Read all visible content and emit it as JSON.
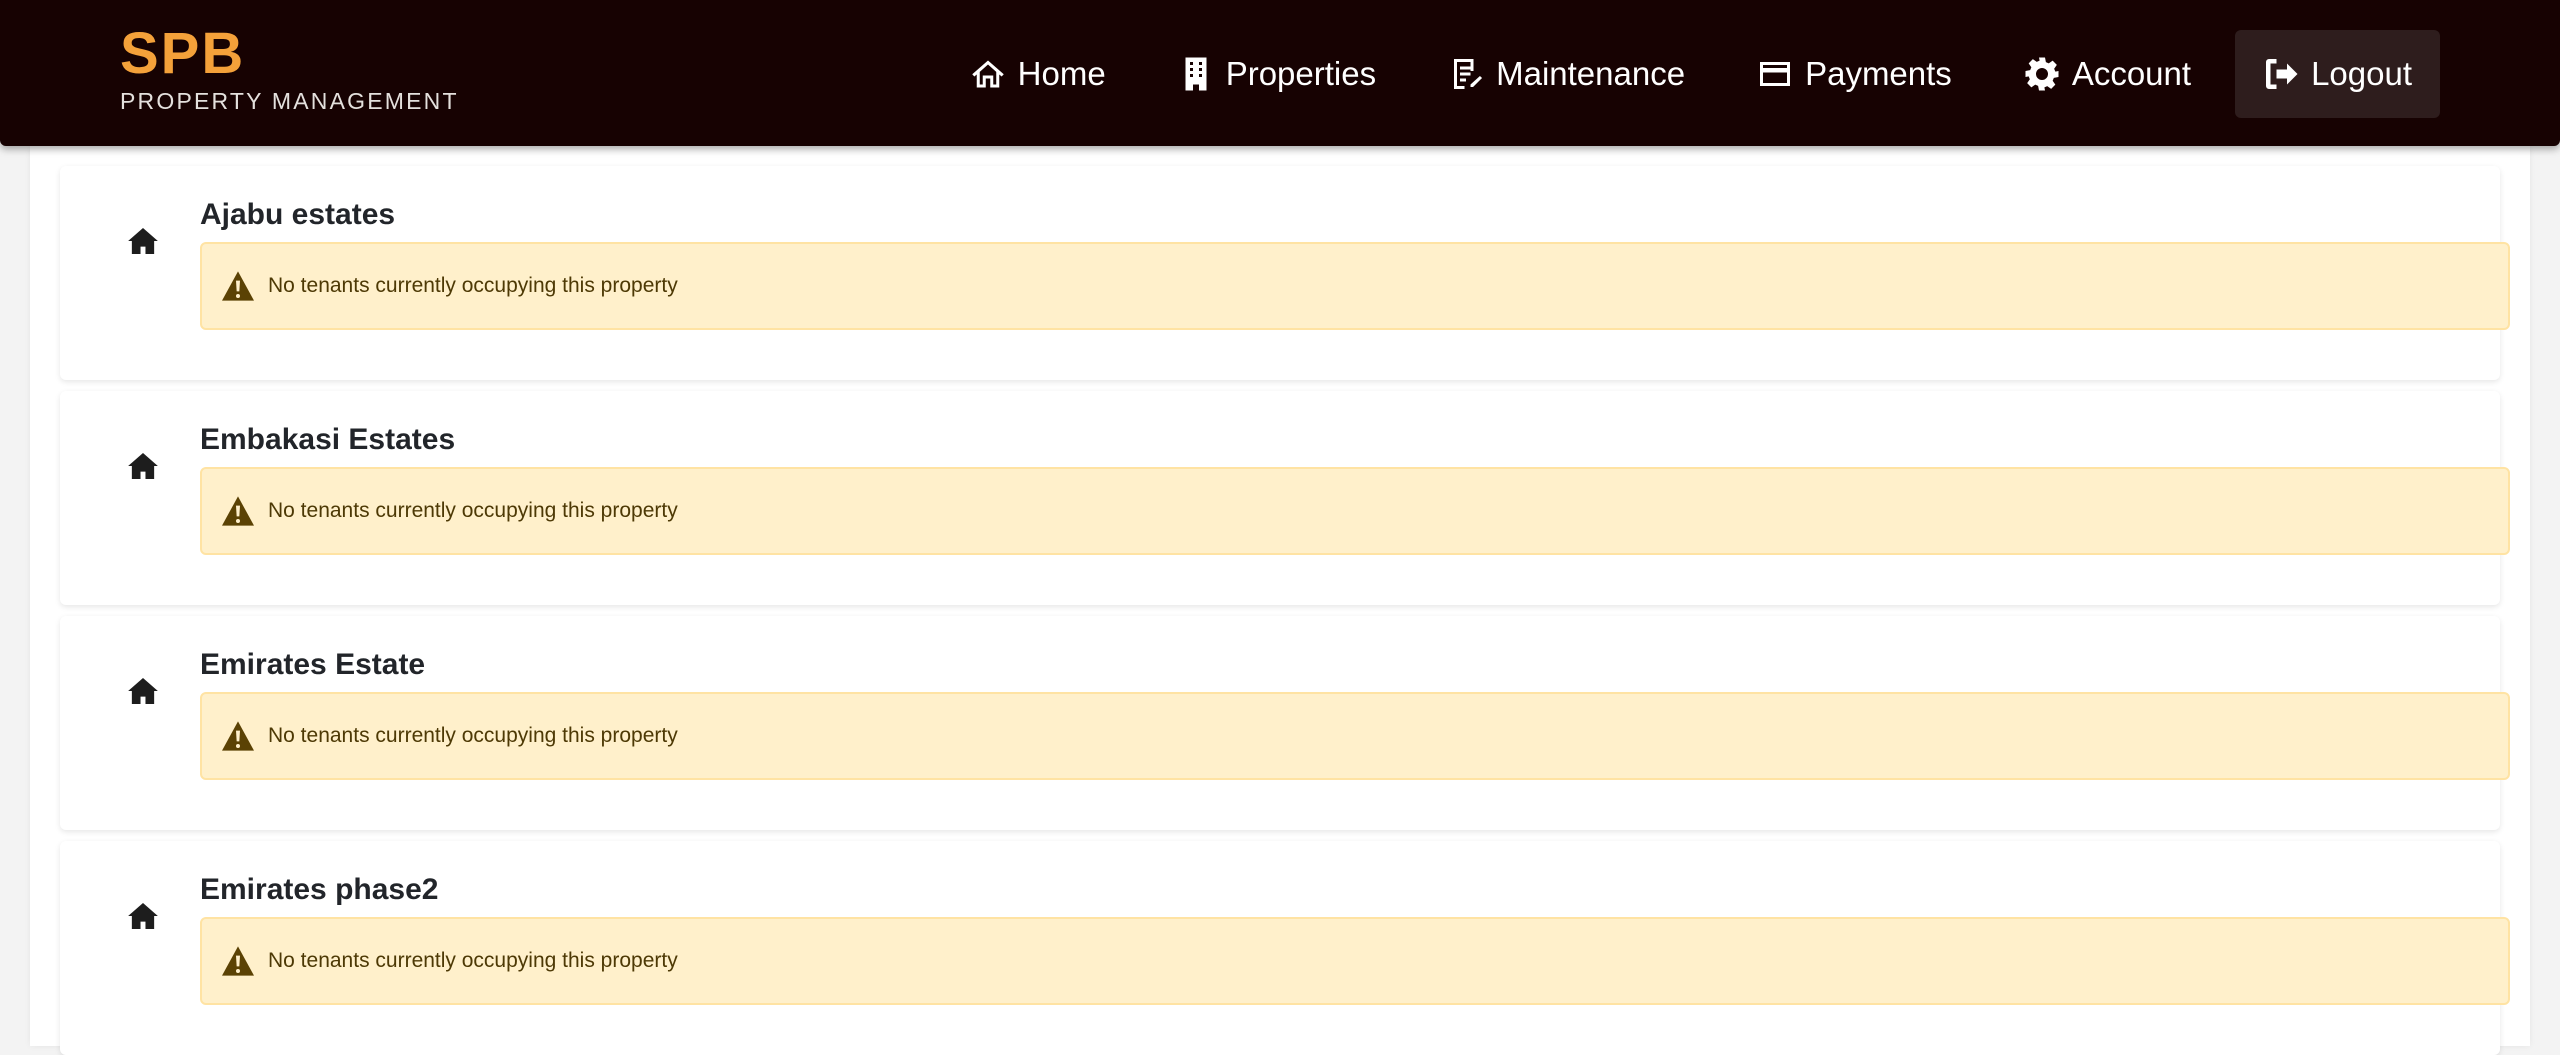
{
  "brand": {
    "name": "SPB",
    "subtitle": "PROPERTY MANAGEMENT"
  },
  "nav": {
    "items": [
      {
        "label": "Home",
        "icon": "home-icon"
      },
      {
        "label": "Properties",
        "icon": "building-icon"
      },
      {
        "label": "Maintenance",
        "icon": "edit-document-icon"
      },
      {
        "label": "Payments",
        "icon": "credit-card-icon"
      },
      {
        "label": "Account",
        "icon": "gear-icon"
      },
      {
        "label": "Logout",
        "icon": "logout-icon"
      }
    ]
  },
  "properties": [
    {
      "name": "Ajabu estates",
      "message": "No tenants currently occupying this property"
    },
    {
      "name": "Embakasi Estates",
      "message": "No tenants currently occupying this property"
    },
    {
      "name": "Emirates Estate",
      "message": "No tenants currently occupying this property"
    },
    {
      "name": "Emirates phase2",
      "message": "No tenants currently occupying this property"
    }
  ],
  "colors": {
    "navbar_bg": "#170202",
    "brand_accent": "#f4a13a",
    "alert_bg": "#fff0cb",
    "alert_border": "#ffe3a3",
    "alert_text": "#4d3905"
  }
}
